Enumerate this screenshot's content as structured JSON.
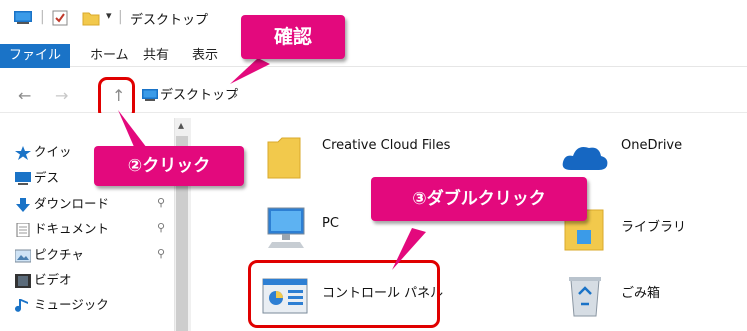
{
  "window": {
    "title": "デスクトップ",
    "title_separator": "|",
    "qa_dropdown": "▾"
  },
  "ribbon": {
    "file_tab": "ファイル",
    "tabs": [
      "ホーム",
      "共有",
      "表示"
    ]
  },
  "address": {
    "back": "←",
    "forward": "→",
    "up": "↑",
    "location": "デスクトップ",
    "chevron": "›"
  },
  "nav": {
    "scroll_up": "▴",
    "items": [
      {
        "label": "クイッ",
        "icon": "star-icon",
        "pinned": false
      },
      {
        "label": "デス",
        "icon": "desktop-icon",
        "pinned": false
      },
      {
        "label": "ダウンロード",
        "icon": "download-icon",
        "pinned": true
      },
      {
        "label": "ドキュメント",
        "icon": "document-icon",
        "pinned": true
      },
      {
        "label": "ピクチャ",
        "icon": "picture-icon",
        "pinned": true
      },
      {
        "label": "ビデオ",
        "icon": "video-icon",
        "pinned": false
      },
      {
        "label": "ミュージック",
        "icon": "music-icon",
        "pinned": false
      }
    ],
    "pin_glyph": "⚲"
  },
  "content": {
    "items": [
      {
        "label": "Creative Cloud Files",
        "icon": "folder-icon"
      },
      {
        "label": "OneDrive",
        "icon": "cloud-icon"
      },
      {
        "label": "PC",
        "icon": "pc-icon"
      },
      {
        "label": "ライブラリ",
        "icon": "library-icon"
      },
      {
        "label": "コントロール パネル",
        "icon": "control-panel-icon"
      },
      {
        "label": "ごみ箱",
        "icon": "recycle-bin-icon"
      }
    ]
  },
  "annotations": {
    "confirm": "確認",
    "click": "②クリック",
    "double_click": "③ダブルクリック"
  },
  "colors": {
    "accent": "#1a73c7",
    "callout": "#e3097d",
    "highlight": "#e00000",
    "folder": "#f2c94c"
  }
}
